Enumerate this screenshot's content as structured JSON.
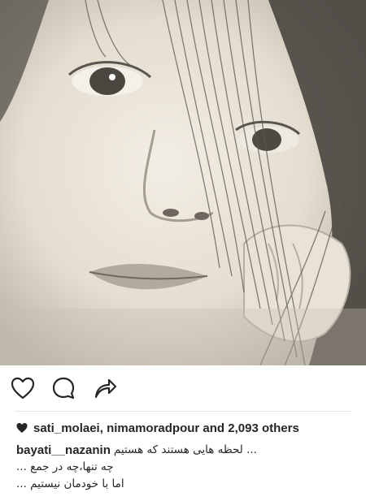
{
  "post": {
    "photo": {
      "description_icon": "portrait-photo"
    },
    "actions": {
      "like_icon": "heart-outline-icon",
      "comment_icon": "comment-bubble-icon",
      "share_icon": "share-arrow-icon"
    },
    "likes": {
      "icon": "heart-filled-icon",
      "user1": "sati_molaei,",
      "user2": "nimamoradpour",
      "connector": "and",
      "count_text": "2,093 others"
    },
    "caption": {
      "username": "bayati__nazanin",
      "line1": "... لحظه هایی هستند که هستیم",
      "line2": "چه تنها،چه در جمع ...",
      "line3": "اما با خودمان نیستیم ..."
    }
  },
  "colors": {
    "text": "#262626",
    "divider": "#e6e6e6",
    "background": "#ffffff"
  }
}
